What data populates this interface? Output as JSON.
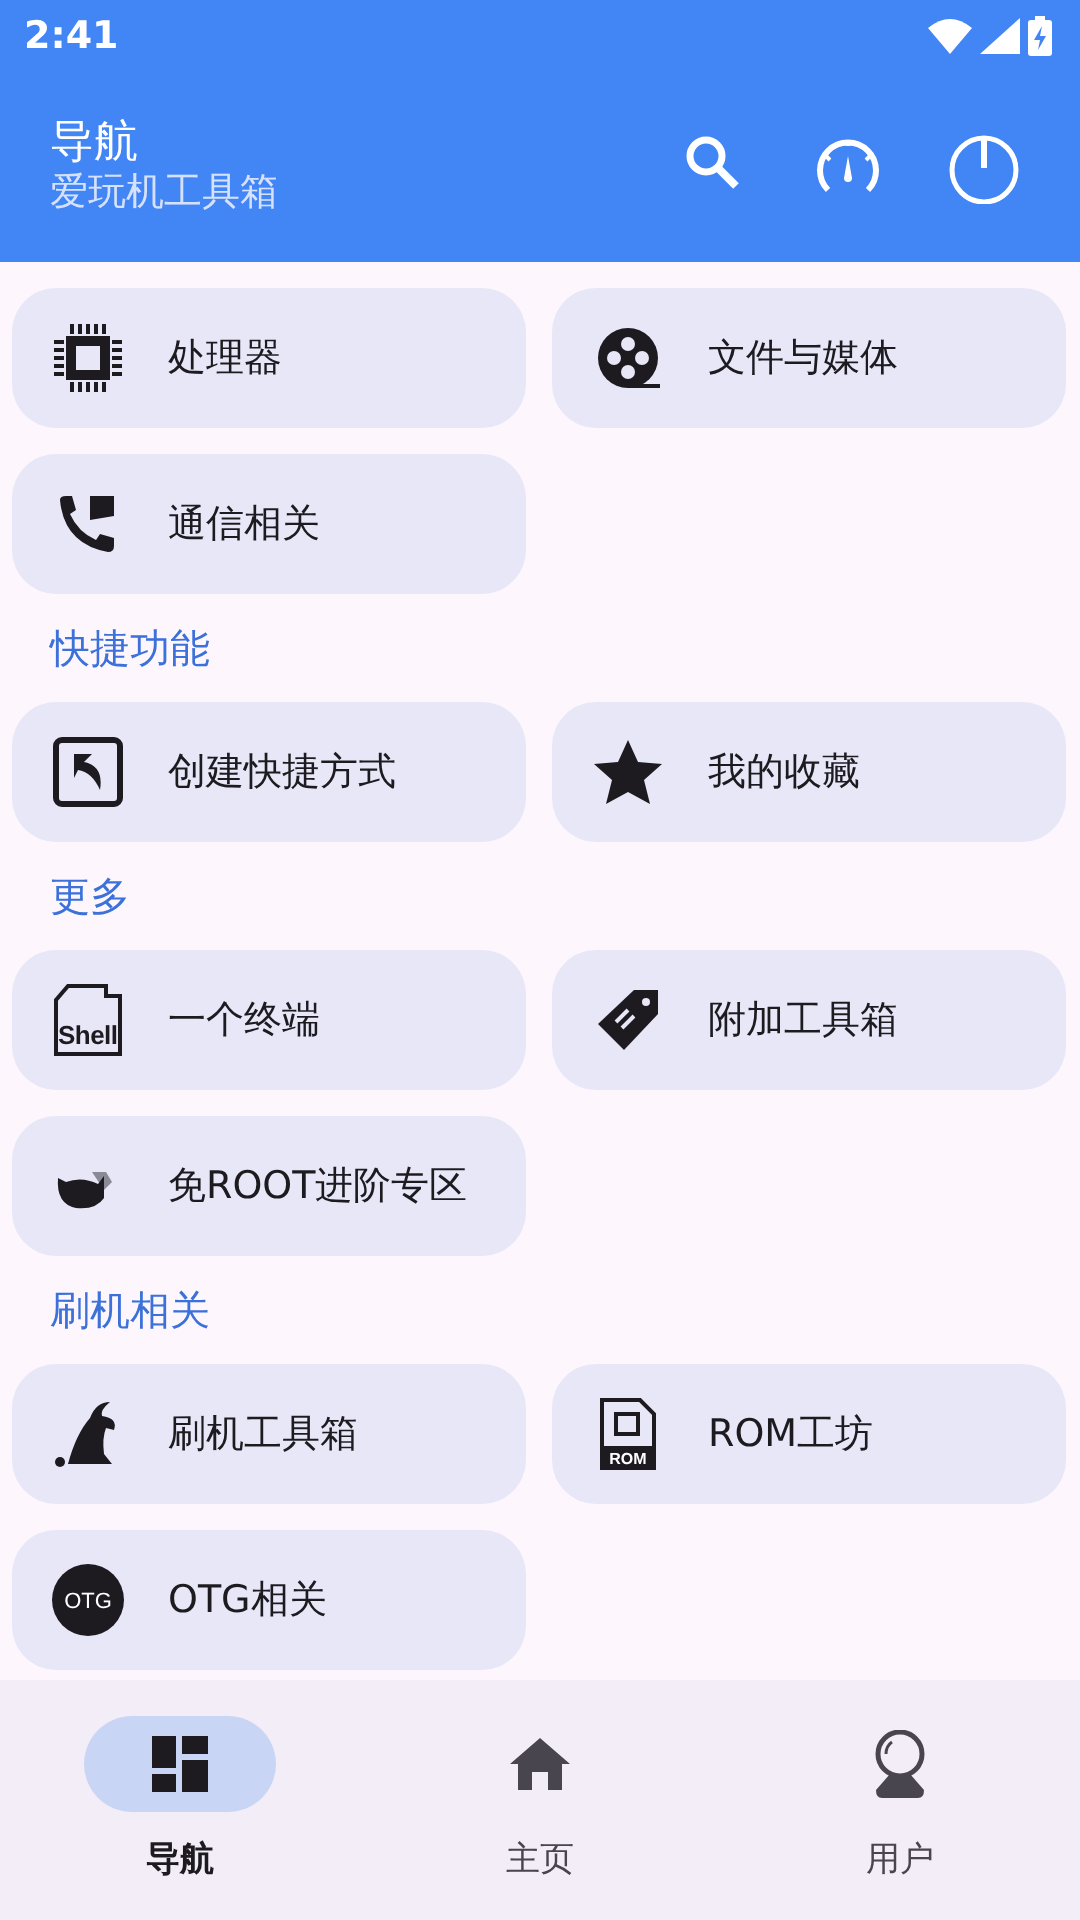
{
  "status_bar": {
    "time": "2:41"
  },
  "app_bar": {
    "title": "导航",
    "subtitle": "爱玩机工具箱"
  },
  "sections": [
    {
      "items": [
        {
          "label": "处理器"
        },
        {
          "label": "文件与媒体"
        },
        {
          "label": "通信相关"
        }
      ]
    },
    {
      "heading": "快捷功能",
      "items": [
        {
          "label": "创建快捷方式"
        },
        {
          "label": "我的收藏"
        }
      ]
    },
    {
      "heading": "更多",
      "items": [
        {
          "label": "一个终端",
          "icon_text": "Shell"
        },
        {
          "label": "附加工具箱"
        },
        {
          "label": "免ROOT进阶专区"
        }
      ]
    },
    {
      "heading": "刷机相关",
      "items": [
        {
          "label": "刷机工具箱"
        },
        {
          "label": "ROM工坊",
          "icon_text": "ROM"
        },
        {
          "label": "OTG相关",
          "icon_text": "OTG"
        }
      ]
    }
  ],
  "bottom_nav": [
    {
      "label": "导航",
      "selected": true
    },
    {
      "label": "主页",
      "selected": false
    },
    {
      "label": "用户",
      "selected": false
    }
  ]
}
